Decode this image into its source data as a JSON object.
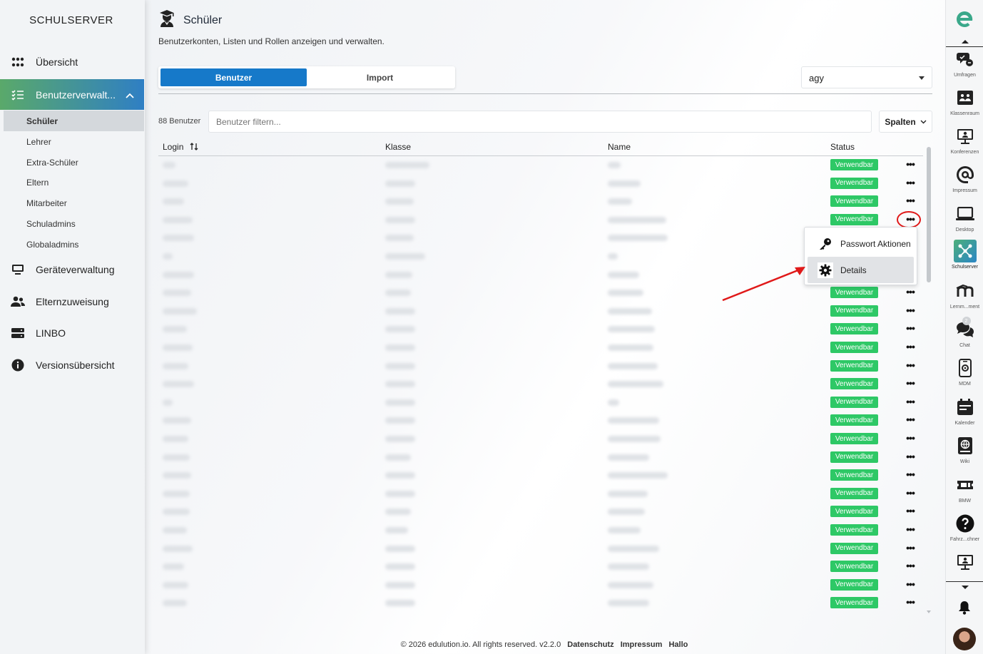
{
  "sidebar": {
    "brand": "SCHULSERVER",
    "items": [
      {
        "label": "Übersicht"
      },
      {
        "label": "Benutzerverwalt..."
      },
      {
        "label": "Geräteverwaltung"
      },
      {
        "label": "Elternzuweisung"
      },
      {
        "label": "LINBO"
      },
      {
        "label": "Versionsübersicht"
      }
    ],
    "subitems": [
      {
        "label": "Schüler"
      },
      {
        "label": "Lehrer"
      },
      {
        "label": "Extra-Schüler"
      },
      {
        "label": "Eltern"
      },
      {
        "label": "Mitarbeiter"
      },
      {
        "label": "Schuladmins"
      },
      {
        "label": "Globaladmins"
      }
    ]
  },
  "page": {
    "title": "Schüler",
    "subtitle": "Benutzerkonten, Listen und Rollen anzeigen und verwalten.",
    "tabs": [
      {
        "label": "Benutzer"
      },
      {
        "label": "Import"
      }
    ],
    "school_select": "agy",
    "user_count": "88 Benutzer",
    "filter_placeholder": "Benutzer filtern...",
    "columns_button": "Spalten"
  },
  "table": {
    "headers": [
      "Login",
      "Klasse",
      "Name",
      "Status"
    ],
    "row_status": "Verwendbar",
    "row_count_visible": 25
  },
  "context_menu": {
    "items": [
      {
        "label": "Passwort Aktionen"
      },
      {
        "label": "Details"
      }
    ]
  },
  "footer": {
    "copyright": "© 2026 edulution.io. All rights reserved. v2.2.0",
    "links": [
      "Datenschutz",
      "Impressum",
      "Hallo"
    ]
  },
  "rail": {
    "items": [
      {
        "label": "Umfragen"
      },
      {
        "label": "Klassenraum"
      },
      {
        "label": "Konferenzen"
      },
      {
        "label": "Impressum"
      },
      {
        "label": "Desktop"
      },
      {
        "label": "Schulserver"
      },
      {
        "label": "Lernm...ment"
      },
      {
        "label": "Chat"
      },
      {
        "label": "MDM"
      },
      {
        "label": "Kalender"
      },
      {
        "label": "Wiki"
      },
      {
        "label": "BMW"
      },
      {
        "label": "Fahrz...chner"
      }
    ],
    "chat_badge": "2"
  },
  "colors": {
    "accent": "#1679c9",
    "status_green": "#2ec866",
    "annotation_red": "#e01919"
  }
}
